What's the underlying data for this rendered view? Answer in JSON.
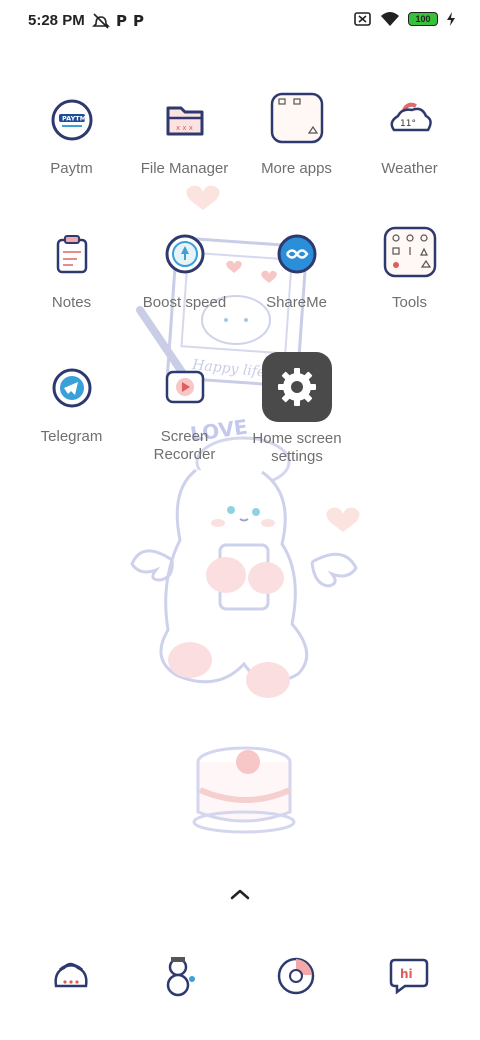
{
  "status_bar": {
    "time": "5:28 PM",
    "battery_level": "100",
    "icons": [
      "alarm-off-icon",
      "paytm-p-icon",
      "paytm-p-icon",
      "sim-none-icon",
      "wifi-icon",
      "battery-icon",
      "charging-icon"
    ]
  },
  "apps": [
    {
      "label": "Paytm",
      "icon": "paytm-icon"
    },
    {
      "label": "File Manager",
      "icon": "folder-icon"
    },
    {
      "label": "More apps",
      "icon": "more-apps-folder-icon"
    },
    {
      "label": "Weather",
      "icon": "weather-cloud-icon",
      "temp": "11°"
    },
    {
      "label": "Notes",
      "icon": "notes-clipboard-icon"
    },
    {
      "label": "Boost speed",
      "icon": "boost-speed-icon"
    },
    {
      "label": "ShareMe",
      "icon": "shareme-icon"
    },
    {
      "label": "Tools",
      "icon": "tools-folder-icon"
    },
    {
      "label": "Telegram",
      "icon": "telegram-icon"
    },
    {
      "label": "Screen\nRecorder",
      "icon": "screen-recorder-icon"
    }
  ],
  "home_screen_settings": {
    "label": "Home screen\nsettings",
    "icon": "gear-icon"
  },
  "wallpaper_text": {
    "love": "LOVE",
    "happy": "Happy life"
  },
  "dock": [
    {
      "icon": "phone-icon"
    },
    {
      "icon": "snowman-icon"
    },
    {
      "icon": "browser-icon"
    },
    {
      "icon": "messages-hi-icon",
      "text": "hi"
    }
  ],
  "colors": {
    "battery": "#39c03a",
    "settings_tile": "#4a4a4a",
    "accent_blue": "#3aa0d8",
    "pink": "#f7c6c6"
  }
}
